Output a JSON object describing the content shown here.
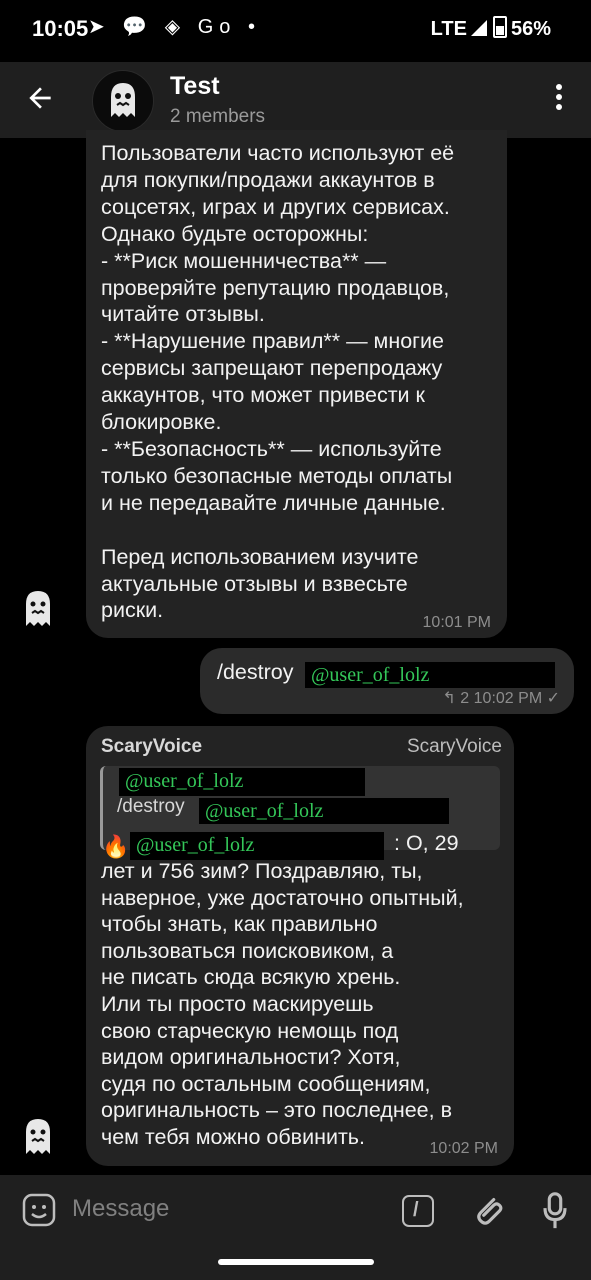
{
  "status_bar": {
    "time": "10:05",
    "app_icons": "➤ 💬 ◈ Go •",
    "network": "LTE",
    "battery": "56%"
  },
  "header": {
    "title": "Test",
    "subtitle": "2 members"
  },
  "messages": [
    {
      "text": "Пользователи часто используют её\nдля покупки/продажи аккаунтов в\nсоцсетях, играх и других сервисах.\nОднако будьте осторожны:\n- **Риск мошенничества** —\nпроверяйте репутацию продавцов,\nчитайте отзывы.\n- **Нарушение правил** — многие\nсервисы запрещают перепродажу\nаккаунтов, что может привести к\nблокировке.\n- **Безопасность** — используйте\nтолько безопасные методы оплаты\nи не передавайте личные данные.\n\nПеред использованием изучите\nактуальные отзывы и взвесьте\nриски.",
      "time": "10:01 PM"
    },
    {
      "command": "/destroy",
      "mention": "@user_of_lolz",
      "reply_count": "↰ 2",
      "time": "10:02 PM",
      "checkmark": "✓"
    },
    {
      "sender": "ScaryVoice",
      "sender_tag": "ScaryVoice",
      "quote_mention": "@user_of_lolz",
      "quote_command": "/destroy",
      "quote_command_mention": "@user_of_lolz",
      "fire_emoji": "🔥",
      "mention": "@user_of_lolz",
      "after_mention": ": О, 29",
      "text": "лет и 756 зим? Поздравляю, ты,\nнаверное, уже достаточно опытный,\nчтобы знать, как правильно\nпользоваться поисковиком, а\nне писать сюда всякую хрень.\nИли ты просто маскируешь\nсвою старческую немощь под\nвидом оригинальности? Хотя,\nсудя по остальным сообщениям,\nоригинальность – это последнее, в\nчем тебя можно обвинить.",
      "time": "10:02 PM"
    }
  ],
  "input": {
    "placeholder": "Message"
  },
  "colors": {
    "background": "#000000",
    "header": "#1f1f1f",
    "bubble": "#232323",
    "mention_text": "#34c759"
  },
  "icons": [
    "back-arrow-icon",
    "more-vert-icon",
    "emoji-icon",
    "bot-command-icon",
    "attach-icon",
    "mic-icon"
  ]
}
